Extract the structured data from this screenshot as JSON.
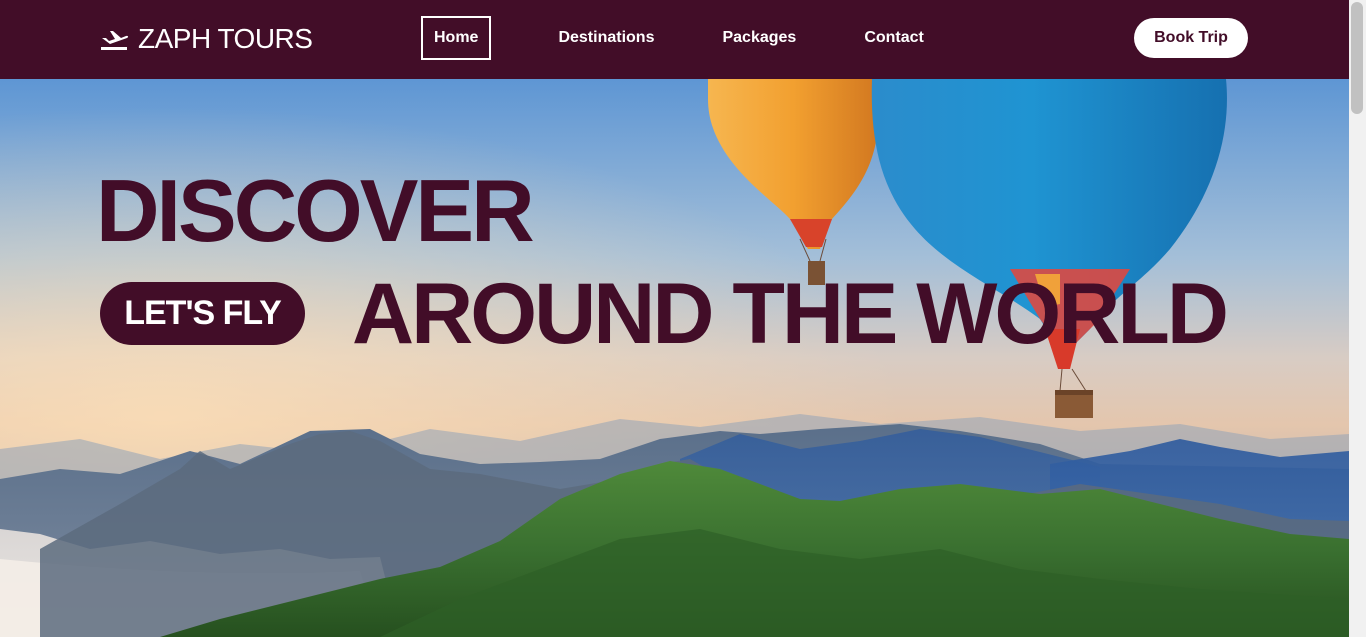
{
  "brand": {
    "name": "ZAPH TOURS",
    "icon": "plane-icon"
  },
  "nav": {
    "items": [
      {
        "label": "Home",
        "active": true
      },
      {
        "label": "Destinations",
        "active": false
      },
      {
        "label": "Packages",
        "active": false
      },
      {
        "label": "Contact",
        "active": false
      }
    ],
    "cta_label": "Book Trip"
  },
  "hero": {
    "line1": "DISCOVER",
    "pill": "LET'S FLY",
    "line2": "AROUND THE WORLD"
  },
  "colors": {
    "brand": "#420d28",
    "text_light": "#ffffff",
    "sky": "#5b95d2",
    "mountain_green": "#3d7a35"
  }
}
